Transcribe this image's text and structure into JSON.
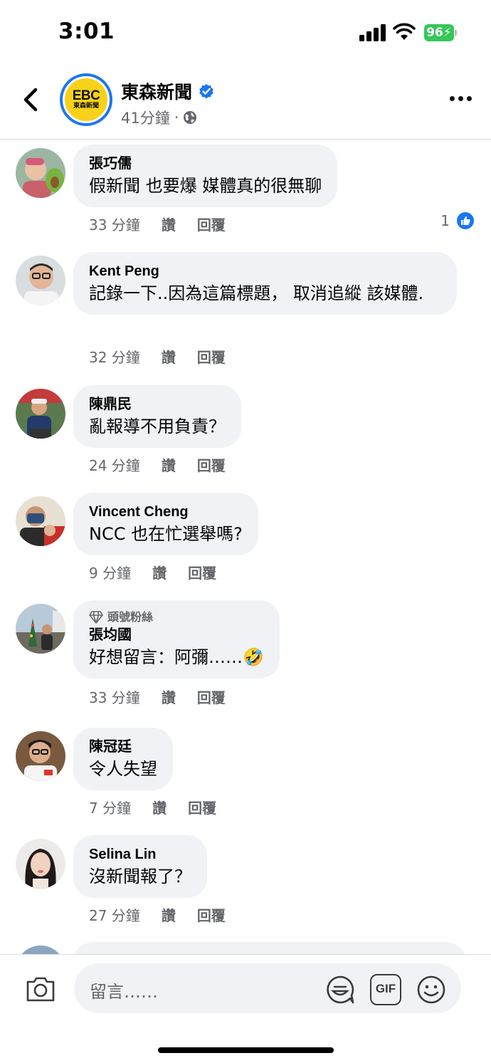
{
  "status_bar": {
    "time": "3:01",
    "battery": "96"
  },
  "header": {
    "page_name": "東森新聞",
    "post_time": "41分鐘",
    "logo_text": "EBC",
    "logo_sub": "東森新聞"
  },
  "comments": [
    {
      "author": "張巧儒",
      "text": "假新聞 也要爆 媒體真的很無聊",
      "time": "33 分鐘",
      "like": "讚",
      "reply": "回覆",
      "reaction_count": "1"
    },
    {
      "author": "Kent Peng",
      "text": "記錄一下..因為這篇標題， 取消追縱 該媒體.",
      "time": "32 分鐘",
      "like": "讚",
      "reply": "回覆"
    },
    {
      "author": "陳鼎民",
      "text": "亂報導不用負責？",
      "time": "24 分鐘",
      "like": "讚",
      "reply": "回覆"
    },
    {
      "author": "Vincent Cheng",
      "text": "NCC 也在忙選舉嗎?",
      "time": "9 分鐘",
      "like": "讚",
      "reply": "回覆"
    },
    {
      "author": "張均國",
      "badge": "頭號粉絲",
      "text": "好想留言：阿彌……🤣",
      "time": "33 分鐘",
      "like": "讚",
      "reply": "回覆"
    },
    {
      "author": "陳冠廷",
      "text": "令人失望",
      "time": "7 分鐘",
      "like": "讚",
      "reply": "回覆"
    },
    {
      "author": "Selina Lin",
      "text": "沒新聞報了？",
      "time": "27 分鐘",
      "like": "讚",
      "reply": "回覆"
    }
  ],
  "composer": {
    "placeholder": "留言……",
    "gif_label": "GIF"
  },
  "colors": {
    "accent": "#1877f2",
    "bubble": "#f0f2f5",
    "meta": "#65676b",
    "battery": "#34c759",
    "logo_yellow": "#f7d11a"
  }
}
